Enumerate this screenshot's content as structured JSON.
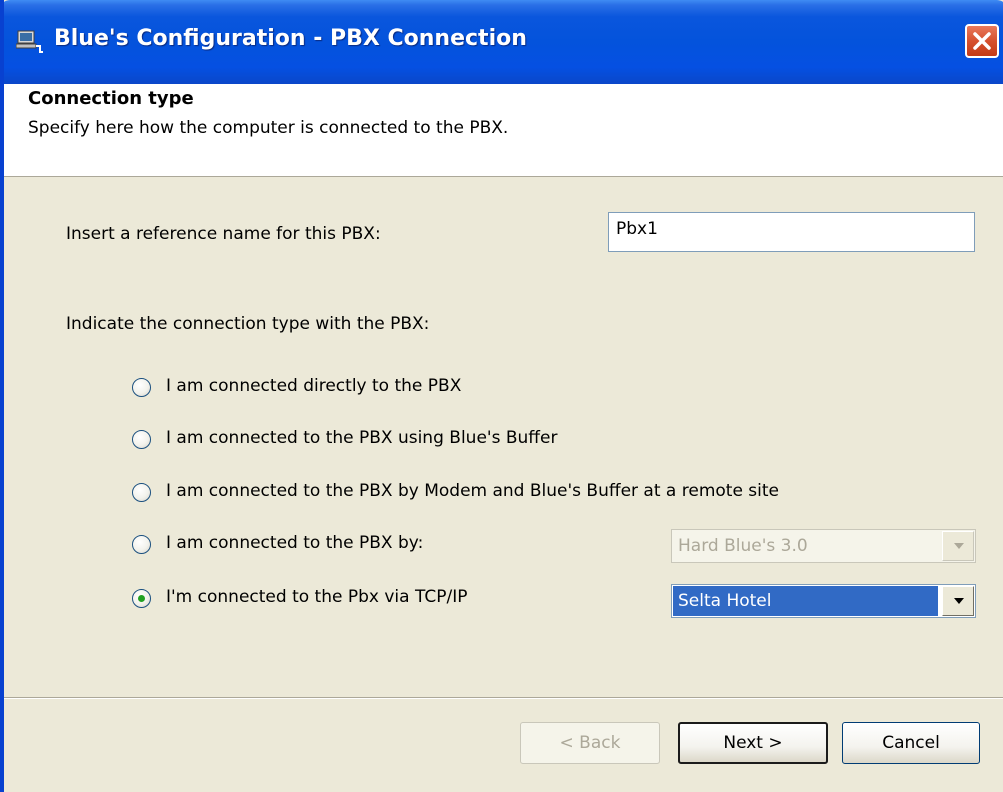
{
  "window": {
    "title": "Blue's Configuration - PBX Connection"
  },
  "header": {
    "title": "Connection type",
    "subtitle": "Specify here how the computer is connected to the PBX."
  },
  "form": {
    "reference_label": "Insert a reference name for this PBX:",
    "reference_value": "Pbx1",
    "connection_label": "Indicate the connection type with the PBX:",
    "options": [
      {
        "label": "I am connected directly to the PBX",
        "selected": false
      },
      {
        "label": "I am connected to the PBX using Blue's Buffer",
        "selected": false
      },
      {
        "label": "I am connected to the PBX by Modem and Blue's Buffer at a remote site",
        "selected": false
      },
      {
        "label": "I am connected to the PBX by:",
        "selected": false
      },
      {
        "label": "I'm connected to the Pbx via TCP/IP",
        "selected": true
      }
    ],
    "pbx_type_select": {
      "value": "Hard Blue's 3.0",
      "enabled": false
    },
    "tcp_select": {
      "value": "Selta Hotel",
      "enabled": true
    }
  },
  "footer": {
    "back_label": "< Back",
    "next_label": "Next >",
    "cancel_label": "Cancel"
  },
  "colors": {
    "titlebar": "#0453dc",
    "dialog_bg": "#ece9d8",
    "selection": "#316ac5",
    "radio_dot": "#21a121"
  }
}
